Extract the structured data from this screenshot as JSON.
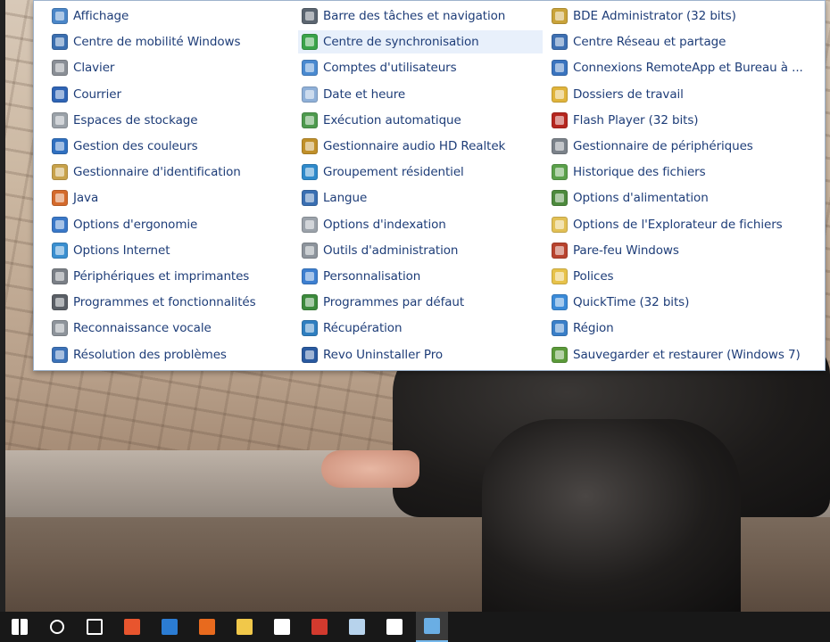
{
  "control_panel": {
    "columns": [
      [
        {
          "label": "Affichage",
          "icon": "display-icon",
          "color": "#4a86c8"
        },
        {
          "label": "Centre de mobilité Windows",
          "icon": "mobility-center-icon",
          "color": "#3b6fb0"
        },
        {
          "label": "Clavier",
          "icon": "keyboard-icon",
          "color": "#8a8f96"
        },
        {
          "label": "Courrier",
          "icon": "mail-icon",
          "color": "#2f64b5"
        },
        {
          "label": "Espaces de stockage",
          "icon": "storage-spaces-icon",
          "color": "#9aa1a8"
        },
        {
          "label": "Gestion des couleurs",
          "icon": "color-management-icon",
          "color": "#3070c0"
        },
        {
          "label": "Gestionnaire d'identification",
          "icon": "credential-manager-icon",
          "color": "#c8a24a"
        },
        {
          "label": "Java",
          "icon": "java-icon",
          "color": "#d46a2c"
        },
        {
          "label": "Options d'ergonomie",
          "icon": "ease-of-access-icon",
          "color": "#3a78c8"
        },
        {
          "label": "Options Internet",
          "icon": "internet-options-icon",
          "color": "#3a8fd0"
        },
        {
          "label": "Périphériques et imprimantes",
          "icon": "printer-icon",
          "color": "#7a7f86"
        },
        {
          "label": "Programmes et fonctionnalités",
          "icon": "programs-features-icon",
          "color": "#5a5f66"
        },
        {
          "label": "Reconnaissance vocale",
          "icon": "microphone-icon",
          "color": "#8e949b"
        },
        {
          "label": "Résolution des problèmes",
          "icon": "troubleshooting-icon",
          "color": "#3c72b8"
        }
      ],
      [
        {
          "label": "Barre des tâches et navigation",
          "icon": "taskbar-icon",
          "color": "#5b6570"
        },
        {
          "label": "Centre de synchronisation",
          "icon": "sync-center-icon",
          "color": "#3aa34a",
          "highlighted": true
        },
        {
          "label": "Comptes d'utilisateurs",
          "icon": "user-accounts-icon",
          "color": "#4a8ad0"
        },
        {
          "label": "Date et heure",
          "icon": "clock-icon",
          "color": "#8fb0d8"
        },
        {
          "label": "Exécution automatique",
          "icon": "autoplay-icon",
          "color": "#4e9a4e"
        },
        {
          "label": "Gestionnaire audio HD Realtek",
          "icon": "realtek-audio-icon",
          "color": "#c0902a"
        },
        {
          "label": "Groupement résidentiel",
          "icon": "homegroup-icon",
          "color": "#2f8acb"
        },
        {
          "label": "Langue",
          "icon": "language-icon",
          "color": "#3a6fb2"
        },
        {
          "label": "Options d'indexation",
          "icon": "indexing-icon",
          "color": "#9ba2aa"
        },
        {
          "label": "Outils d'administration",
          "icon": "admin-tools-icon",
          "color": "#8d949c"
        },
        {
          "label": "Personnalisation",
          "icon": "personalization-icon",
          "color": "#3d7fd0"
        },
        {
          "label": "Programmes par défaut",
          "icon": "default-programs-icon",
          "color": "#3c8a3c"
        },
        {
          "label": "Récupération",
          "icon": "recovery-icon",
          "color": "#2f7fc0"
        },
        {
          "label": "Revo Uninstaller Pro",
          "icon": "revo-uninstaller-icon",
          "color": "#2a5aa0"
        }
      ],
      [
        {
          "label": "BDE Administrator (32 bits)",
          "icon": "bde-admin-icon",
          "color": "#c9a33a"
        },
        {
          "label": "Centre Réseau et partage",
          "icon": "network-center-icon",
          "color": "#3d6fb2"
        },
        {
          "label": "Connexions RemoteApp et Bureau à ...",
          "icon": "remoteapp-icon",
          "color": "#3a74bf"
        },
        {
          "label": "Dossiers de travail",
          "icon": "work-folders-icon",
          "color": "#e0b43c"
        },
        {
          "label": "Flash Player (32 bits)",
          "icon": "flash-player-icon",
          "color": "#b5261f"
        },
        {
          "label": "Gestionnaire de périphériques",
          "icon": "device-manager-icon",
          "color": "#7b828a"
        },
        {
          "label": "Historique des fichiers",
          "icon": "file-history-icon",
          "color": "#5aa04a"
        },
        {
          "label": "Options d'alimentation",
          "icon": "power-options-icon",
          "color": "#4d8a3d"
        },
        {
          "label": "Options de l'Explorateur de fichiers",
          "icon": "explorer-options-icon",
          "color": "#e2c055"
        },
        {
          "label": "Pare-feu Windows",
          "icon": "firewall-icon",
          "color": "#b8432e"
        },
        {
          "label": "Polices",
          "icon": "fonts-icon",
          "color": "#e7c24a"
        },
        {
          "label": "QuickTime (32 bits)",
          "icon": "quicktime-icon",
          "color": "#3a8ad8"
        },
        {
          "label": "Région",
          "icon": "region-icon",
          "color": "#3a7fc8"
        },
        {
          "label": "Sauvegarder et restaurer (Windows 7)",
          "icon": "backup-restore-icon",
          "color": "#5b9a3a"
        }
      ]
    ]
  },
  "taskbar": {
    "items": [
      {
        "icon": "windows-start-icon",
        "color": "#ffffff"
      },
      {
        "icon": "search-icon",
        "color": "#ffffff"
      },
      {
        "icon": "task-view-icon",
        "color": "#ffffff"
      },
      {
        "icon": "app-red-square-icon",
        "color": "#e8552e"
      },
      {
        "icon": "edge-icon",
        "color": "#2b7cd3"
      },
      {
        "icon": "firefox-icon",
        "color": "#e86a1e"
      },
      {
        "icon": "file-explorer-icon",
        "color": "#f1c84a"
      },
      {
        "icon": "store-icon",
        "color": "#ffffff"
      },
      {
        "icon": "ccleaner-icon",
        "color": "#d23a2e"
      },
      {
        "icon": "notepad-icon",
        "color": "#b7d3ec"
      },
      {
        "icon": "mail-app-icon",
        "color": "#ffffff"
      },
      {
        "icon": "control-panel-icon",
        "color": "#6aaee4",
        "active": true
      }
    ]
  }
}
